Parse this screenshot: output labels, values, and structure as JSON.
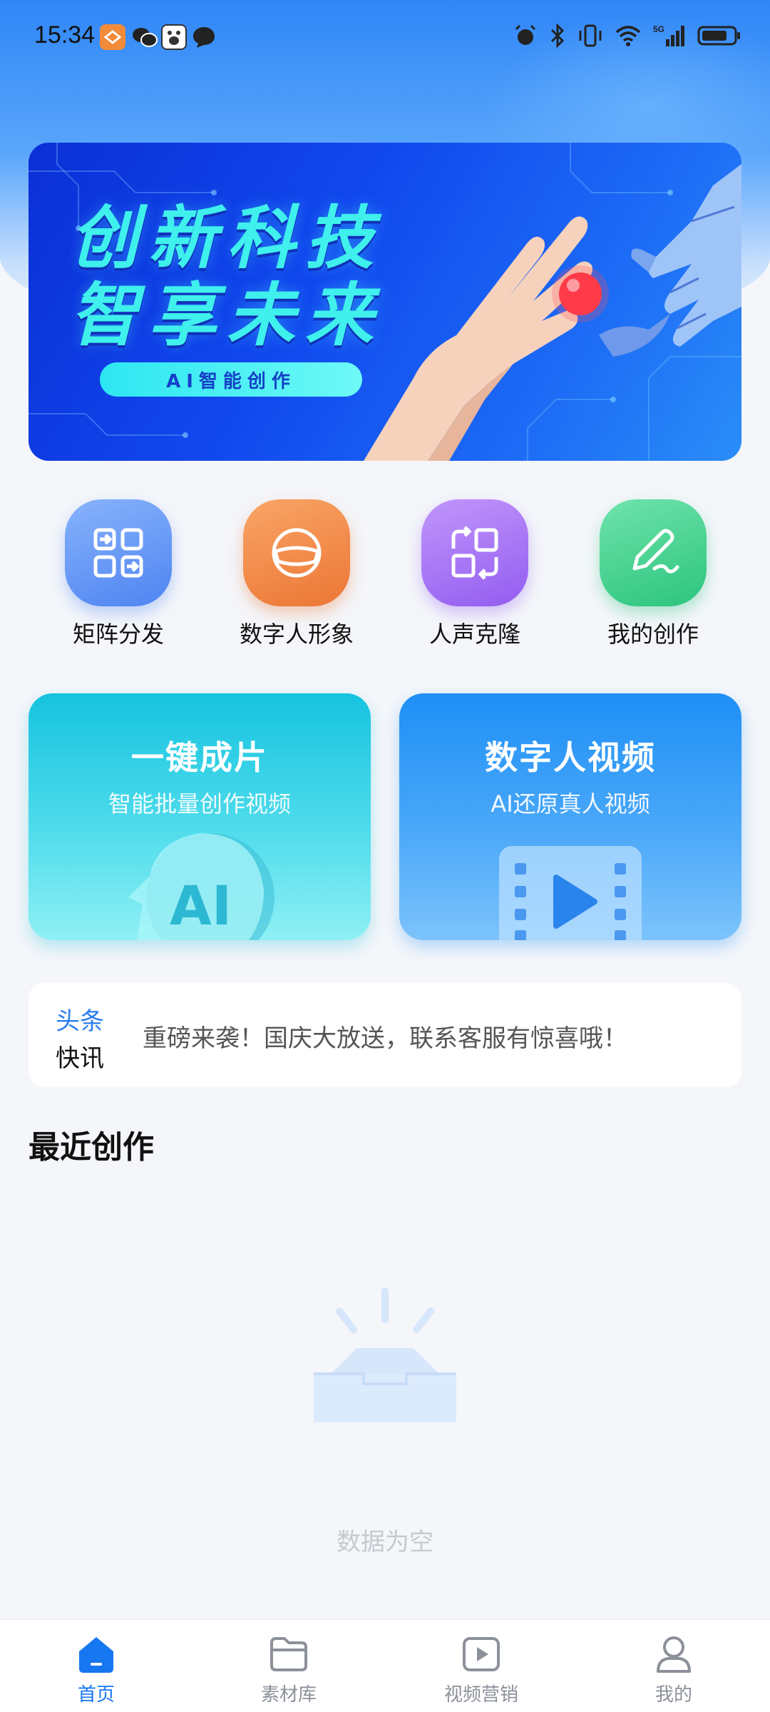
{
  "status_bar": {
    "time": "15:34",
    "network_label": "5G"
  },
  "banner": {
    "title_line1": "创新科技",
    "title_line2": "智享未来",
    "pill": "AI智能创作"
  },
  "quick_actions": [
    {
      "label": "矩阵分发",
      "icon": "grid-icon",
      "color": "#5f92f5"
    },
    {
      "label": "数字人形象",
      "icon": "vr-headset-icon",
      "color": "#f08a3e"
    },
    {
      "label": "人声克隆",
      "icon": "clone-icon",
      "color": "#a272f2"
    },
    {
      "label": "我的创作",
      "icon": "pen-icon",
      "color": "#3ccf8c"
    }
  ],
  "feature_cards": [
    {
      "title": "一键成片",
      "subtitle": "智能批量创作视频",
      "badge": "AI"
    },
    {
      "title": "数字人视频",
      "subtitle": "AI还原真人视频"
    }
  ],
  "news": {
    "tag_line1": "头条",
    "tag_line2": "快讯",
    "text": "重磅来袭！国庆大放送，联系客服有惊喜哦！"
  },
  "recent": {
    "title": "最近创作",
    "empty_text": "数据为空"
  },
  "tabbar": {
    "items": [
      {
        "label": "首页",
        "icon": "home-icon",
        "active": true
      },
      {
        "label": "素材库",
        "icon": "folder-icon",
        "active": false
      },
      {
        "label": "视频营销",
        "icon": "video-play-icon",
        "active": false
      },
      {
        "label": "我的",
        "icon": "user-icon",
        "active": false
      }
    ]
  },
  "colors": {
    "accent": "#1677f0",
    "background": "#f4f6fa",
    "banner_text": "#3ff0ec"
  }
}
